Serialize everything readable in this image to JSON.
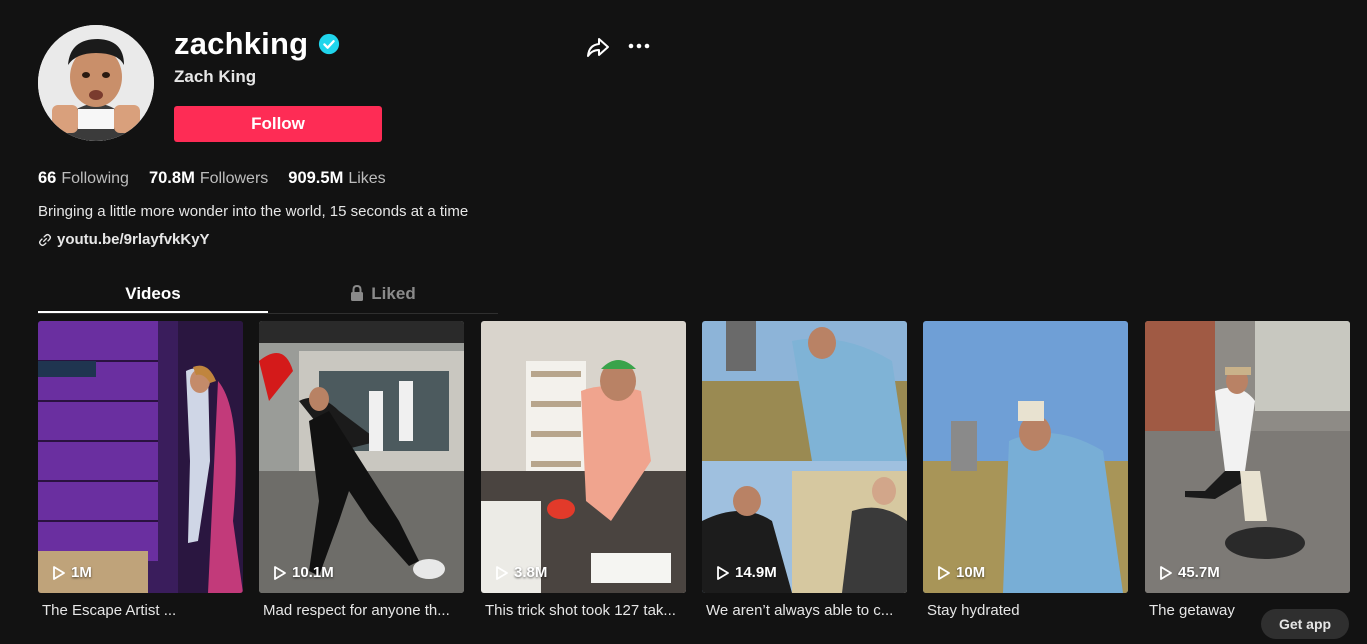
{
  "profile": {
    "username": "zachking",
    "display_name": "Zach King",
    "follow_label": "Follow",
    "verified_icon": "verified-badge-icon",
    "accent_color": "#fe2c55"
  },
  "stats": [
    {
      "value": "66",
      "label": "Following"
    },
    {
      "value": "70.8M",
      "label": "Followers"
    },
    {
      "value": "909.5M",
      "label": "Likes"
    }
  ],
  "bio": "Bringing a little more wonder into the world, 15 seconds at a time",
  "link": "youtu.be/9rlayfvkKyY",
  "tabs": [
    {
      "label": "Videos",
      "active": true
    },
    {
      "label": "Liked",
      "active": false,
      "icon": "lock-icon"
    }
  ],
  "videos": [
    {
      "views": "1M",
      "caption": "The Escape Artist ..."
    },
    {
      "views": "10.1M",
      "caption": "Mad respect for anyone th..."
    },
    {
      "views": "3.8M",
      "caption": "This trick shot took 127 tak..."
    },
    {
      "views": "14.9M",
      "caption": "We aren’t always able to c..."
    },
    {
      "views": "10M",
      "caption": "Stay hydrated"
    },
    {
      "views": "45.7M",
      "caption": "The getaway"
    }
  ],
  "get_app_label": "Get app"
}
